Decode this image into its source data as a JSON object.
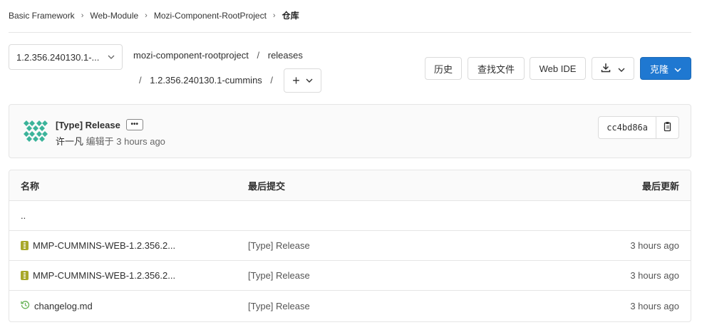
{
  "breadcrumb": {
    "items": [
      "Basic Framework",
      "Web-Module",
      "Mozi-Component-RootProject"
    ],
    "current": "仓库",
    "separator": "›"
  },
  "branch": {
    "label": "1.2.356.240130.1-..."
  },
  "path": {
    "project": "mozi-component-rootproject",
    "dir1": "releases",
    "dir2": "1.2.356.240130.1-cummins",
    "separator": "/"
  },
  "toolbar": {
    "history": "历史",
    "find_file": "查找文件",
    "web_ide": "Web IDE",
    "clone": "克隆",
    "add_symbol": "+"
  },
  "commit": {
    "title": "[Type] Release",
    "ellipsis": "•••",
    "author": "许一凡",
    "meta": "编辑于 3 hours ago",
    "sha": "cc4bd86a"
  },
  "table": {
    "headers": {
      "name": "名称",
      "last_commit": "最后提交",
      "last_update": "最后更新"
    },
    "parent_link": "..",
    "rows": [
      {
        "icon": "archive-icon",
        "name": "MMP-CUMMINS-WEB-1.2.356.2...",
        "commit": "[Type] Release",
        "updated": "3 hours ago"
      },
      {
        "icon": "archive-icon",
        "name": "MMP-CUMMINS-WEB-1.2.356.2...",
        "commit": "[Type] Release",
        "updated": "3 hours ago"
      },
      {
        "icon": "history-icon",
        "name": "changelog.md",
        "commit": "[Type] Release",
        "updated": "3 hours ago"
      }
    ]
  },
  "colors": {
    "primary": "#1f78d1",
    "archive": "#a8a82a",
    "history_icon": "#6bb55b",
    "avatar": "#3bb39a"
  }
}
